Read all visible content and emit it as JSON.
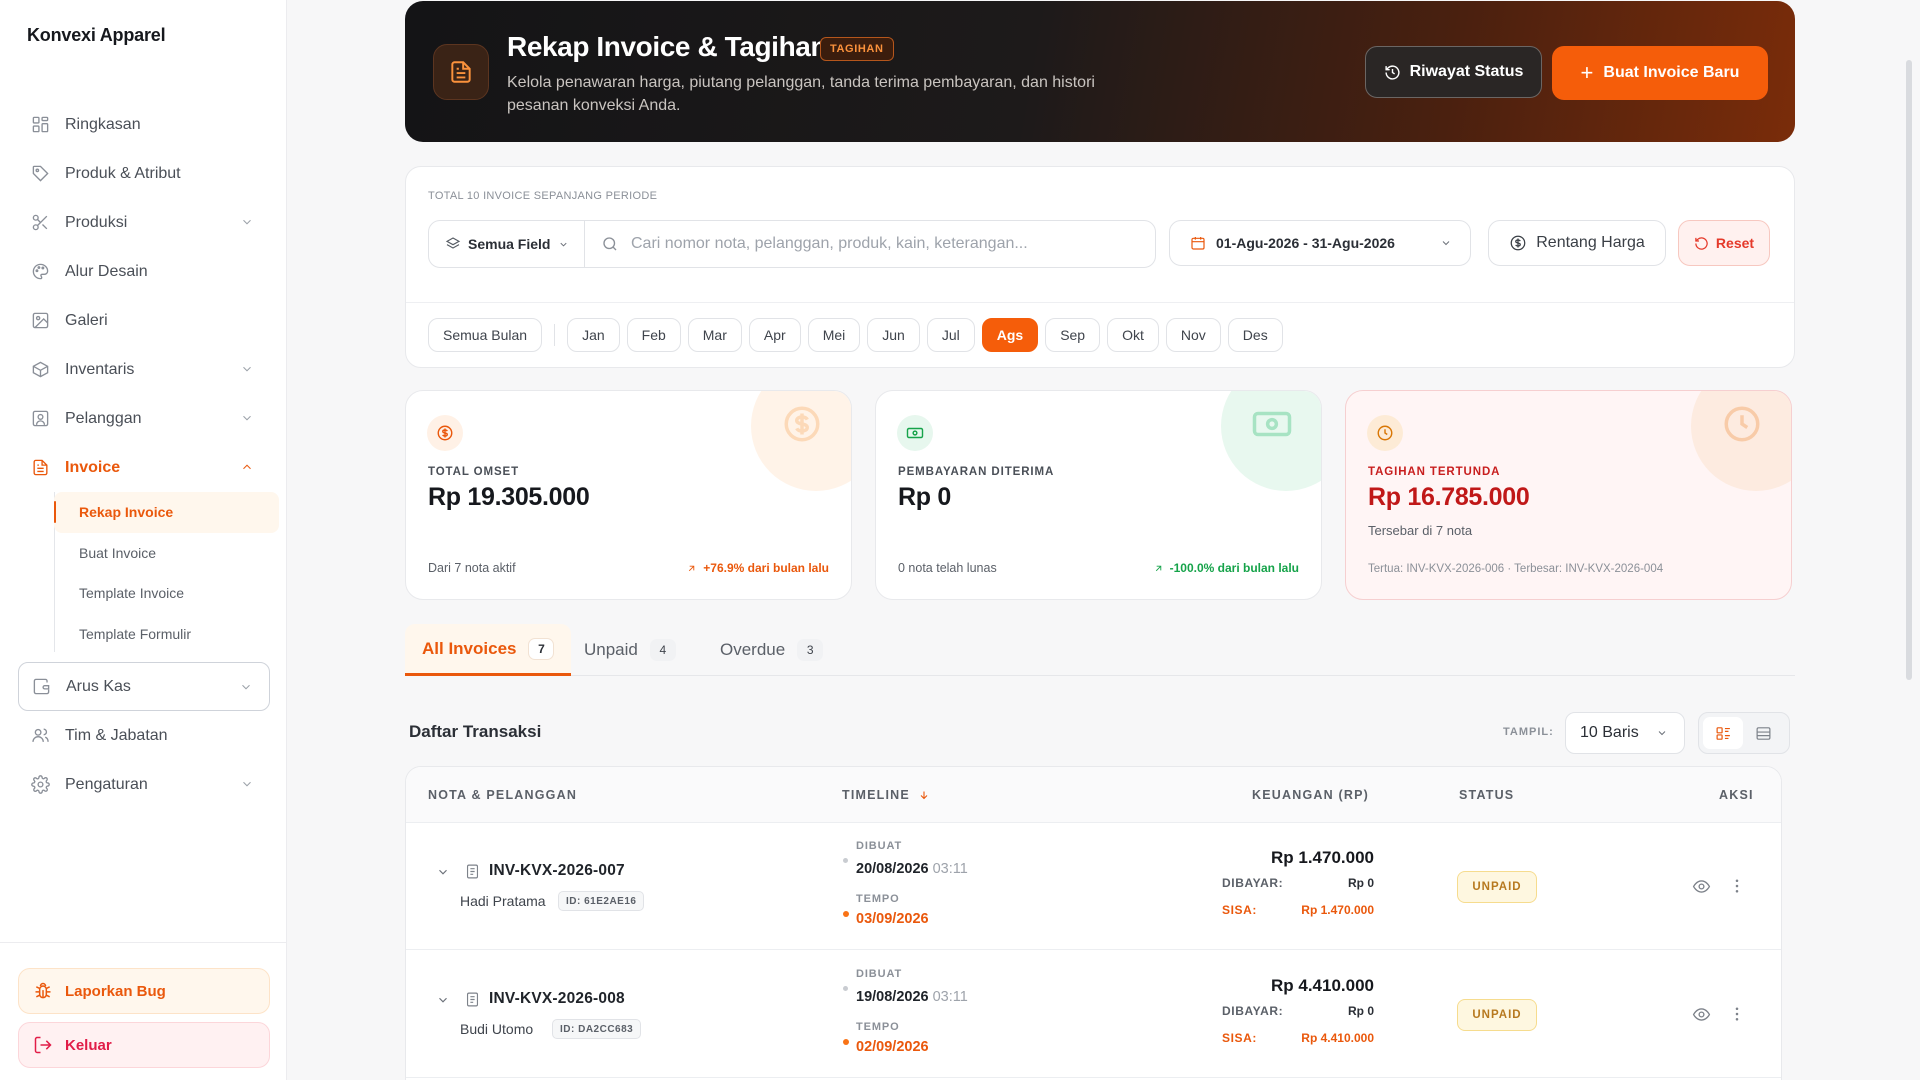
{
  "app": {
    "brand": "Konvexi Apparel"
  },
  "sidebar": {
    "items": [
      {
        "label": "Ringkasan",
        "icon": "dashboard-icon"
      },
      {
        "label": "Produk & Atribut",
        "icon": "tag-icon"
      },
      {
        "label": "Produksi",
        "icon": "scissors-icon"
      },
      {
        "label": "Alur Desain",
        "icon": "palette-icon"
      },
      {
        "label": "Galeri",
        "icon": "gallery-icon"
      },
      {
        "label": "Inventaris",
        "icon": "box-icon"
      },
      {
        "label": "Pelanggan",
        "icon": "customer-icon"
      },
      {
        "label": "Invoice",
        "icon": "invoice-icon"
      },
      {
        "label": "Arus Kas",
        "icon": "wallet-icon"
      },
      {
        "label": "Tim & Jabatan",
        "icon": "team-icon"
      },
      {
        "label": "Pengaturan",
        "icon": "gear-icon"
      }
    ],
    "invoice_sub": [
      "Rekap Invoice",
      "Buat Invoice",
      "Template Invoice",
      "Template Formulir"
    ],
    "report_bug": "Laporkan Bug",
    "logout": "Keluar"
  },
  "hero": {
    "title": "Rekap Invoice & Tagihan",
    "badge": "TAGIHAN",
    "subtitle": "Kelola penawaran harga, piutang pelanggan, tanda terima pembayaran, dan histori pesanan konveksi Anda.",
    "history_btn": "Riwayat Status",
    "new_btn": "Buat Invoice Baru"
  },
  "filters": {
    "total_label": "TOTAL 10 INVOICE SEPANJANG PERIODE",
    "field_select": "Semua Field",
    "search_placeholder": "Cari nomor nota, pelanggan, produk, kain, keterangan...",
    "date_range": "01-Agu-2026 - 31-Agu-2026",
    "price_range": "Rentang Harga",
    "reset": "Reset",
    "all_months": "Semua Bulan",
    "months": [
      "Jan",
      "Feb",
      "Mar",
      "Apr",
      "Mei",
      "Jun",
      "Jul",
      "Ags",
      "Sep",
      "Okt",
      "Nov",
      "Des"
    ],
    "active_month": "Ags"
  },
  "stats": {
    "omset": {
      "label": "TOTAL OMSET",
      "value": "Rp 19.305.000",
      "foot": "Dari 7 nota aktif",
      "trend": "+76.9% dari bulan lalu"
    },
    "received": {
      "label": "PEMBAYARAN DITERIMA",
      "value": "Rp 0",
      "foot": "0 nota telah lunas",
      "trend": "-100.0% dari bulan lalu"
    },
    "pending": {
      "label": "TAGIHAN TERTUNDA",
      "value": "Rp 16.785.000",
      "sub": "Tersebar di 7 nota",
      "foot": "Tertua: INV-KVX-2026-006 · Terbesar: INV-KVX-2026-004"
    }
  },
  "tabs": [
    {
      "label": "All Invoices",
      "count": "7"
    },
    {
      "label": "Unpaid",
      "count": "4"
    },
    {
      "label": "Overdue",
      "count": "3"
    }
  ],
  "list": {
    "title": "Daftar Transaksi",
    "show_label": "TAMPIL:",
    "rows_per_page": "10 Baris"
  },
  "table": {
    "headers": {
      "nota": "NOTA & PELANGGAN",
      "timeline": "TIMELINE",
      "finance": "KEUANGAN (RP)",
      "status": "STATUS",
      "action": "AKSI"
    },
    "created_label": "DIBUAT",
    "due_label": "TEMPO",
    "paid_label": "DIBAYAR:",
    "rest_label": "SISA:",
    "rows": [
      {
        "nota": "INV-KVX-2026-007",
        "customer": "Hadi Pratama",
        "cid": "ID: 61E2AE16",
        "created_date": "20/08/2026",
        "created_time": "03:11",
        "due": "03/09/2026",
        "amount": "Rp 1.470.000",
        "paid": "Rp 0",
        "rest": "Rp 1.470.000",
        "status": "UNPAID"
      },
      {
        "nota": "INV-KVX-2026-008",
        "customer": "Budi Utomo",
        "cid": "ID: DA2CC683",
        "created_date": "19/08/2026",
        "created_time": "03:11",
        "due": "02/09/2026",
        "amount": "Rp 4.410.000",
        "paid": "Rp 0",
        "rest": "Rp 4.410.000",
        "status": "UNPAID"
      }
    ]
  },
  "colors": {
    "accent": "#f55d0a",
    "danger": "#e5392a",
    "pending": "#c2410c"
  }
}
